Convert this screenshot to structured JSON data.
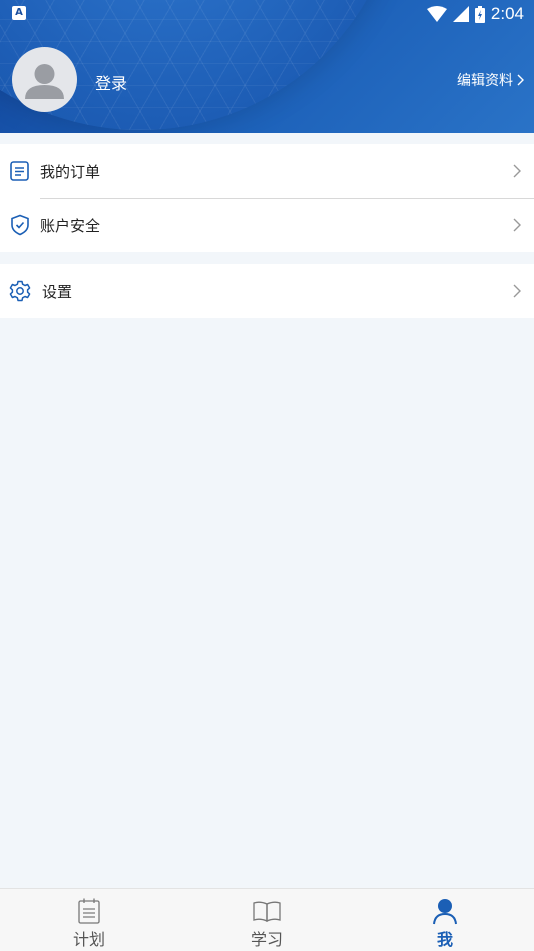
{
  "status_bar": {
    "left_icon": "A",
    "time": "2:04"
  },
  "profile": {
    "login_label": "登录",
    "edit_label": "编辑资料"
  },
  "menu": {
    "orders_label": "我的订单",
    "security_label": "账户安全",
    "settings_label": "设置"
  },
  "tabbar": {
    "tabs": [
      {
        "label": "计划",
        "icon": "calendar-list-icon",
        "active": false
      },
      {
        "label": "学习",
        "icon": "open-book-icon",
        "active": false
      },
      {
        "label": "我",
        "icon": "user-icon",
        "active": true
      }
    ]
  },
  "colors": {
    "header": "#1a5db6",
    "accent": "#1b5fb5",
    "background": "#f2f6fa"
  }
}
